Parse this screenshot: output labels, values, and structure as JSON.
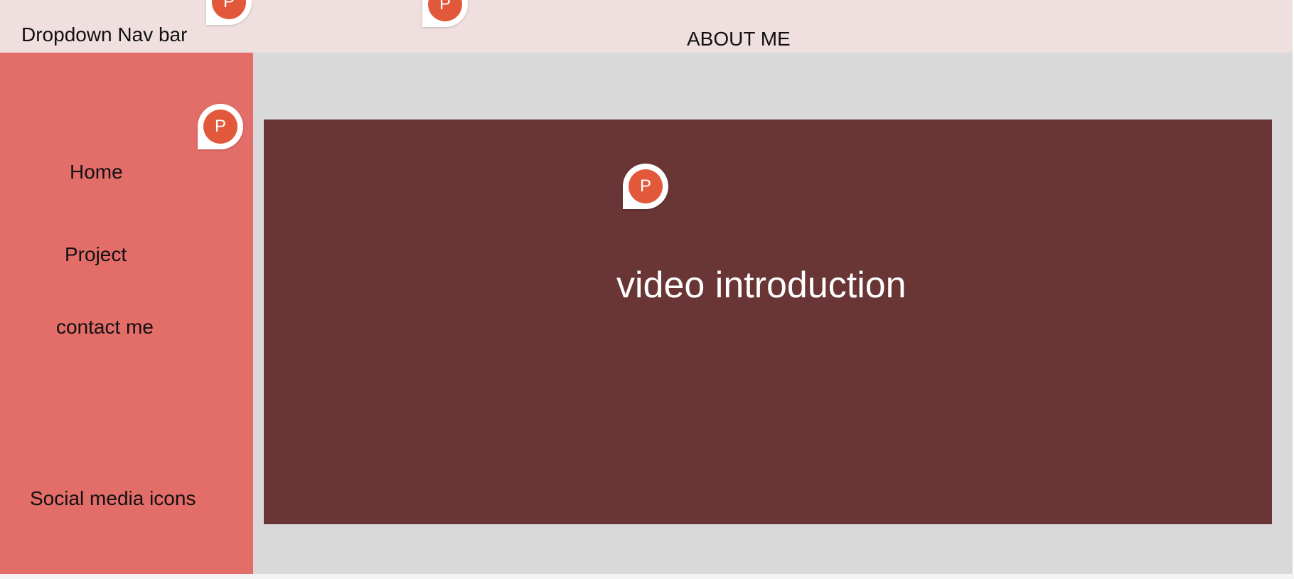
{
  "header": {
    "nav_title": "Dropdown Nav bar",
    "page_title": "ABOUT ME"
  },
  "sidebar": {
    "items": [
      {
        "label": "Home"
      },
      {
        "label": "Project"
      },
      {
        "label": "contact me"
      }
    ],
    "social_label": "Social media icons"
  },
  "main": {
    "video_label": "video introduction"
  },
  "comment_pins": [
    {
      "initial": "P"
    },
    {
      "initial": "P"
    },
    {
      "initial": "P"
    },
    {
      "initial": "P"
    }
  ],
  "colors": {
    "topbar": "#efdfdf",
    "sidebar": "#e36d69",
    "main_background": "#d9d9d9",
    "video_panel": "#693535",
    "comment_pin": "#e2583a"
  },
  "icons": {
    "comment_pin": "comment-pin-icon"
  }
}
